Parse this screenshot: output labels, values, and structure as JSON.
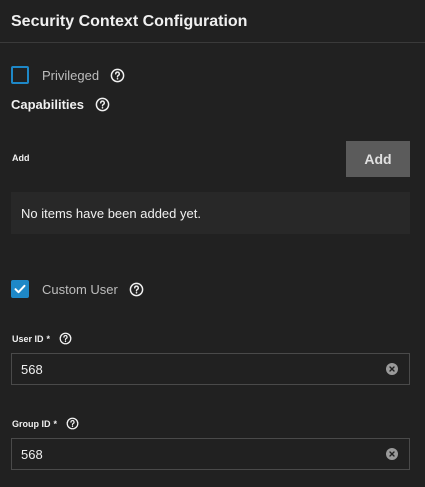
{
  "section": {
    "title": "Security Context Configuration"
  },
  "privileged": {
    "label": "Privileged",
    "checked": false
  },
  "capabilities": {
    "title": "Capabilities",
    "add_label": "Add",
    "add_button": "Add",
    "empty_text": "No items have been added yet."
  },
  "custom_user": {
    "label": "Custom User",
    "checked": true
  },
  "user_id": {
    "label": "User ID",
    "required_mark": "*",
    "value": "568"
  },
  "group_id": {
    "label": "Group ID",
    "required_mark": "*",
    "value": "568"
  },
  "colors": {
    "accent": "#1e88c7",
    "background": "#212121",
    "button": "#5b5b5b"
  }
}
